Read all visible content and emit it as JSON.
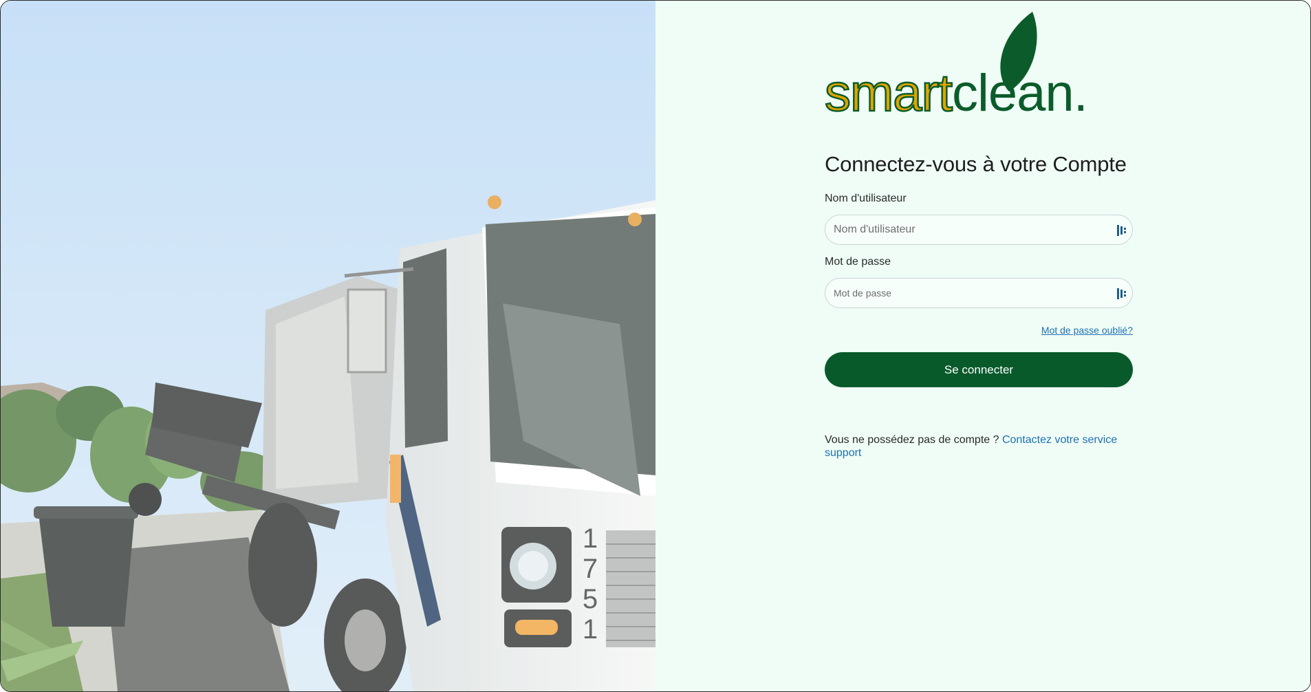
{
  "brand": {
    "logo_part1": "smart",
    "logo_part2": "clean.",
    "colors": {
      "gold": "#e2a300",
      "green": "#0b5c2a"
    }
  },
  "login": {
    "title": "Connectez-vous à votre Compte",
    "username_label": "Nom d'utilisateur",
    "username_placeholder": "Nom d'utilisateur",
    "username_value": "",
    "password_label": "Mot de passe",
    "password_placeholder": "Mot de passe",
    "password_value": "",
    "forgot_link": "Mot de passe oublié?",
    "submit_label": "Se connecter",
    "no_account_text": "Vous ne possédez pas de compte ?",
    "contact_link": "Contactez votre service support"
  },
  "hero_image": {
    "truck_number": "1751"
  },
  "icons": {
    "field_icon": "password-manager-key-icon"
  },
  "colors": {
    "panel_bg": "#effdf6",
    "primary_button": "#085a2b",
    "link": "#1f6fb5"
  }
}
